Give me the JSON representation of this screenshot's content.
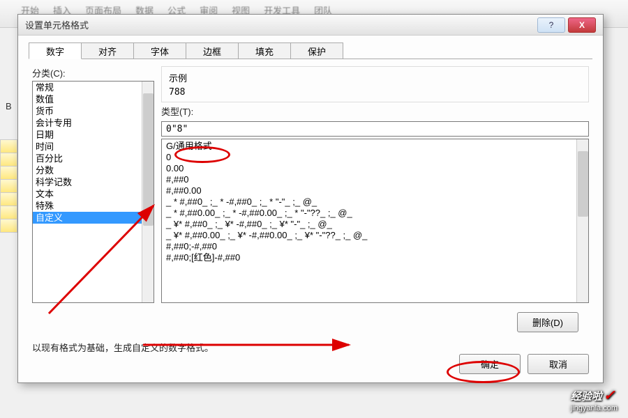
{
  "ribbon": {
    "tabs": [
      "开始",
      "插入",
      "页面布局",
      "数据",
      "公式",
      "审阅",
      "视图",
      "开发工具",
      "团队"
    ]
  },
  "cell_label": "B",
  "dialog": {
    "title": "设置单元格格式",
    "tabs": [
      "数字",
      "对齐",
      "字体",
      "边框",
      "填充",
      "保护"
    ],
    "active_tab_index": 0,
    "category_label": "分类(C):",
    "categories": [
      "常规",
      "数值",
      "货币",
      "会计专用",
      "日期",
      "时间",
      "百分比",
      "分数",
      "科学记数",
      "文本",
      "特殊",
      "自定义"
    ],
    "selected_category": "自定义",
    "sample_label": "示例",
    "sample_value": "788",
    "type_label": "类型(T):",
    "type_value": "0\"8\"",
    "formats": [
      "G/通用格式",
      "0",
      "0.00",
      "#,##0",
      "#,##0.00",
      "_ * #,##0_ ;_ * -#,##0_ ;_ * \"-\"_ ;_ @_ ",
      "_ * #,##0.00_ ;_ * -#,##0.00_ ;_ * \"-\"??_ ;_ @_ ",
      "_ ¥* #,##0_ ;_ ¥* -#,##0_ ;_ ¥* \"-\"_ ;_ @_ ",
      "_ ¥* #,##0.00_ ;_ ¥* -#,##0.00_ ;_ ¥* \"-\"??_ ;_ @_ ",
      "#,##0;-#,##0",
      "#,##0;[红色]-#,##0"
    ],
    "delete_btn": "删除(D)",
    "hint": "以现有格式为基础，生成自定义的数字格式。",
    "ok_btn": "确定",
    "cancel_btn": "取消",
    "help_glyph": "?",
    "close_glyph": "X"
  },
  "watermark": {
    "main": "经验啦",
    "sub": "jingyanla.com",
    "check": "✓"
  }
}
